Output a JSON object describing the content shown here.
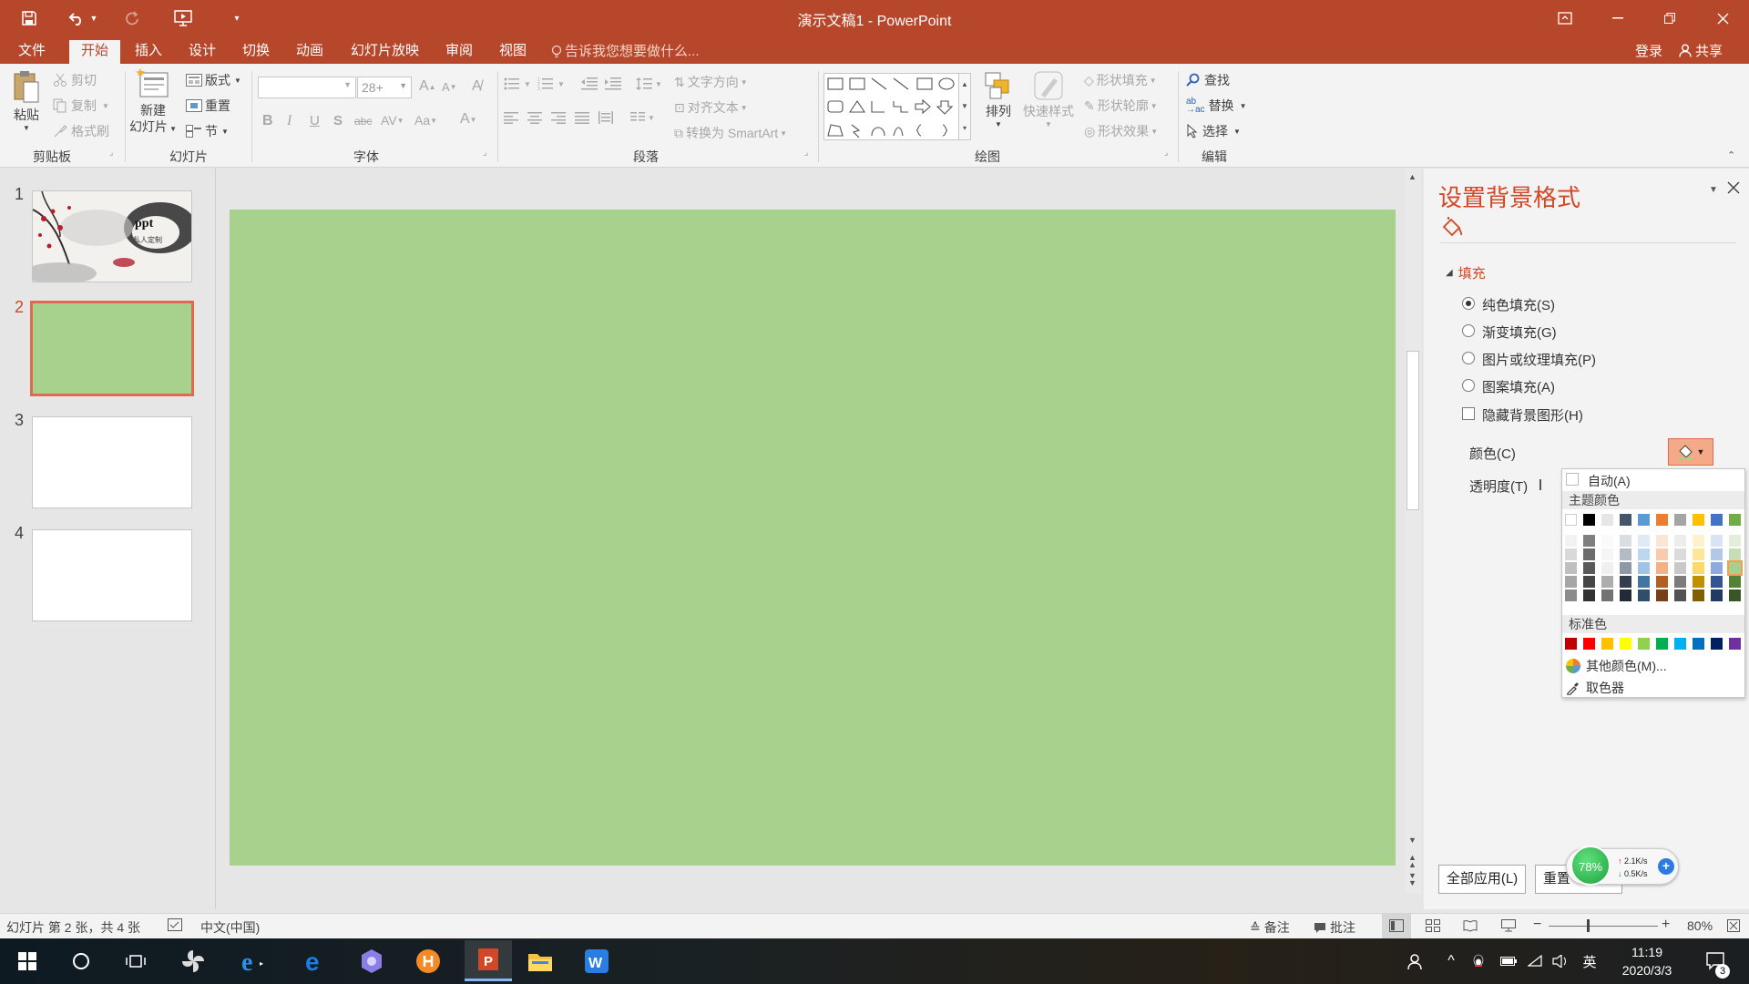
{
  "window": {
    "title": "演示文稿1 - PowerPoint"
  },
  "tabs": [
    "文件",
    "开始",
    "插入",
    "设计",
    "切换",
    "动画",
    "幻灯片放映",
    "审阅",
    "视图"
  ],
  "tell_me": "告诉我您想要做什么...",
  "account": {
    "login": "登录",
    "share": "共享"
  },
  "clipboard": {
    "paste": "粘贴",
    "cut": "剪切",
    "copy": "复制",
    "format_painter": "格式刷",
    "label": "剪贴板"
  },
  "slides_group": {
    "new_slide_line1": "新建",
    "new_slide_line2": "幻灯片",
    "layout": "版式",
    "reset": "重置",
    "section": "节",
    "label": "幻灯片"
  },
  "font": {
    "size": "28+",
    "label": "字体"
  },
  "paragraph": {
    "text_direction": "文字方向",
    "align_text": "对齐文本",
    "convert_smartart": "转换为 SmartArt",
    "label": "段落"
  },
  "drawing": {
    "arrange": "排列",
    "quick_styles": "快速样式",
    "shape_fill": "形状填充",
    "shape_outline": "形状轮廓",
    "shape_effects": "形状效果",
    "label": "绘图"
  },
  "editing": {
    "find": "查找",
    "replace": "替换",
    "select": "选择",
    "label": "编辑"
  },
  "thumbnails": [
    {
      "num": "1",
      "title": "ppt",
      "subtitle": "私人定制"
    },
    {
      "num": "2"
    },
    {
      "num": "3"
    },
    {
      "num": "4"
    }
  ],
  "format_pane": {
    "title": "设置背景格式",
    "fill_section": "填充",
    "options": [
      "纯色填充(S)",
      "渐变填充(G)",
      "图片或纹理填充(P)",
      "图案填充(A)"
    ],
    "hide_bg": "隐藏背景图形(H)",
    "color_label": "颜色(C)",
    "transparency_label": "透明度(T)",
    "apply_all": "全部应用(L)",
    "reset": "重置"
  },
  "color_picker": {
    "auto": "自动(A)",
    "theme_label": "主题颜色",
    "standard_label": "标准色",
    "more": "其他颜色(M)...",
    "eyedropper": "取色器",
    "theme_colors": [
      "#ffffff",
      "#000000",
      "#e7e6e6",
      "#44546a",
      "#5b9bd5",
      "#ed7d31",
      "#a5a5a5",
      "#ffc000",
      "#4472c4",
      "#70ad47"
    ],
    "standard_colors": [
      "#c00000",
      "#ff0000",
      "#ffc000",
      "#ffff00",
      "#92d050",
      "#00b050",
      "#00b0f0",
      "#0070c0",
      "#002060",
      "#7030a0"
    ]
  },
  "net_widget": {
    "percent": "78%",
    "up": "2.1K/s",
    "down": "0.5K/s"
  },
  "status": {
    "slide_info": "幻灯片 第 2 张，共 4 张",
    "language": "中文(中国)",
    "notes": "备注",
    "comments": "批注",
    "zoom": "80%"
  },
  "taskbar": {
    "time": "11:19",
    "date": "2020/3/3",
    "ime": "英",
    "notif_count": "3"
  }
}
